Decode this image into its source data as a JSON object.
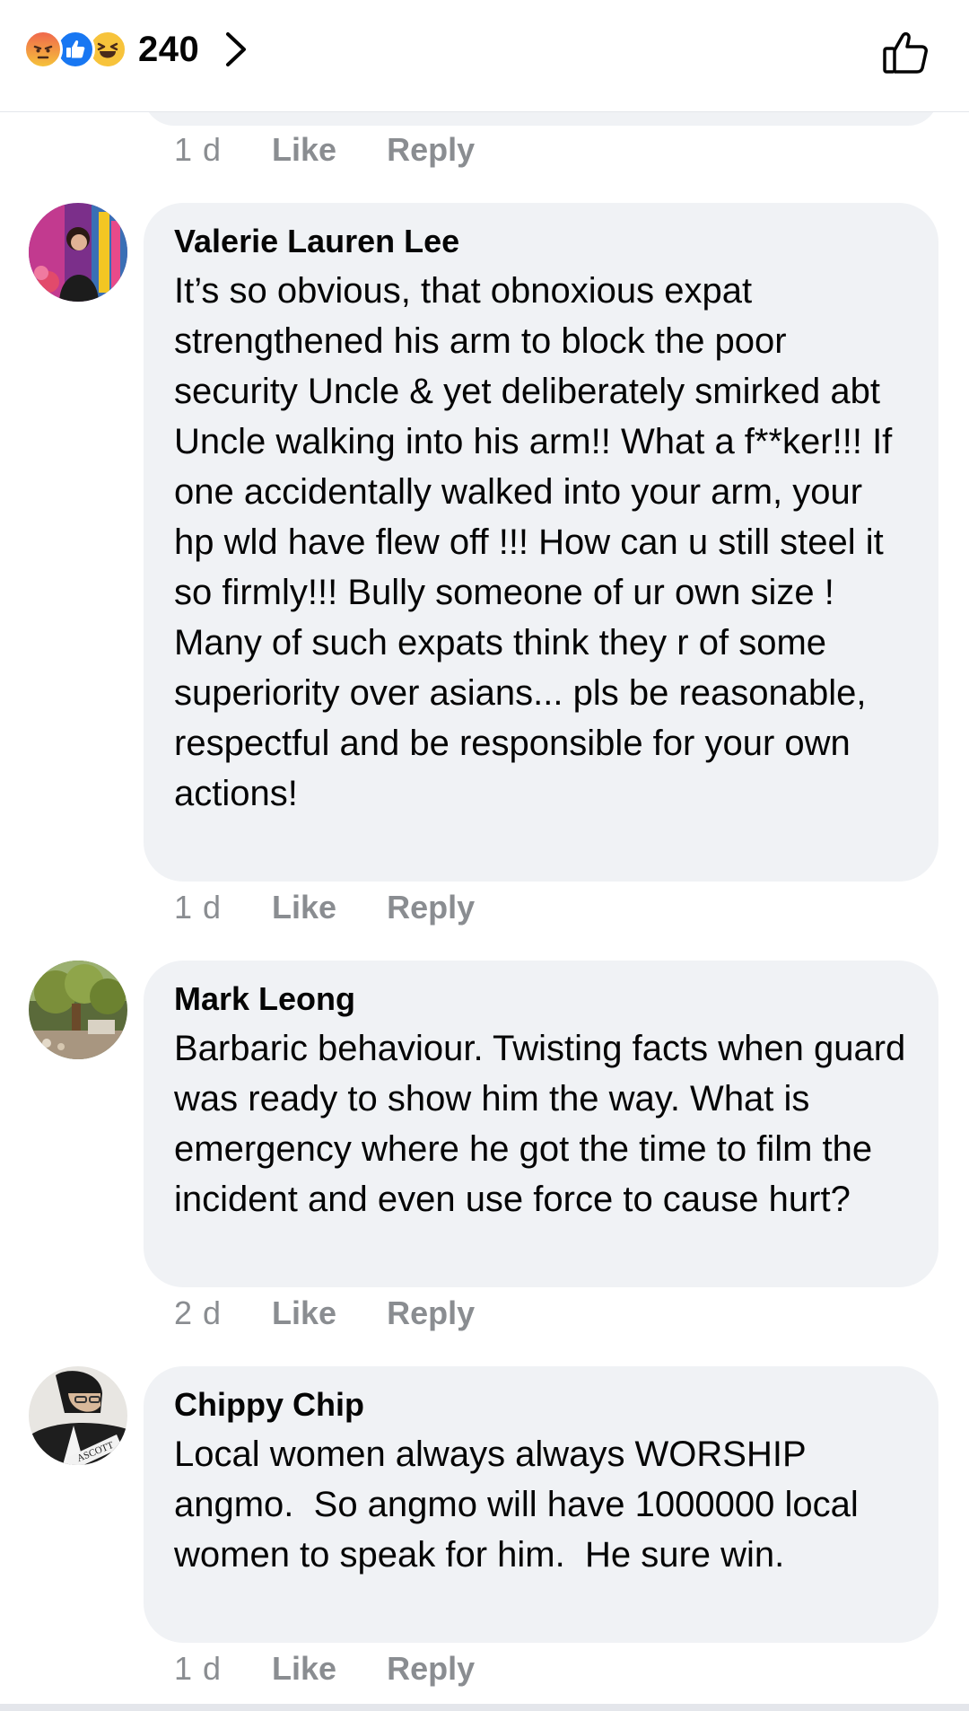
{
  "header": {
    "reaction_icons": [
      "angry-icon",
      "like-icon",
      "haha-icon"
    ],
    "reaction_count": "240",
    "like_button_icon": "thumbs-up-outline-icon"
  },
  "colors": {
    "bubble": "#f0f2f5",
    "meta_text": "#8a8d91",
    "like_blue": "#1877f2"
  },
  "previous_comment_meta": {
    "time": "1 d",
    "like": "Like",
    "reply": "Reply"
  },
  "comments": [
    {
      "author": "Valerie Lauren Lee",
      "text": "It’s so obvious, that obnoxious expat strengthened his arm to block the poor security Uncle & yet deliberately smirked abt Uncle walking into his arm!! What a f**ker!!! If one accidentally walked into your arm, your hp wld have flew off !!! How can u still steel it so firmly!!! Bully someone of ur own size ! Many of such expats think they r of some superiority over asians... pls be reasonable, respectful and be responsible for your own actions!",
      "time": "1 d",
      "like": "Like",
      "reply": "Reply"
    },
    {
      "author": "Mark Leong",
      "text": "Barbaric behaviour. Twisting facts when guard was ready to show him the way. What is emergency where he got the time to film the incident and even use force to cause hurt?",
      "time": "2 d",
      "like": "Like",
      "reply": "Reply"
    },
    {
      "author": "Chippy Chip",
      "text": "Local women always always WORSHIP angmo.  So angmo will have 1000000 local women to speak for him.  He sure win.",
      "time": "1 d",
      "like": "Like",
      "reply": "Reply",
      "avatar_text": "ASCOTT"
    }
  ]
}
